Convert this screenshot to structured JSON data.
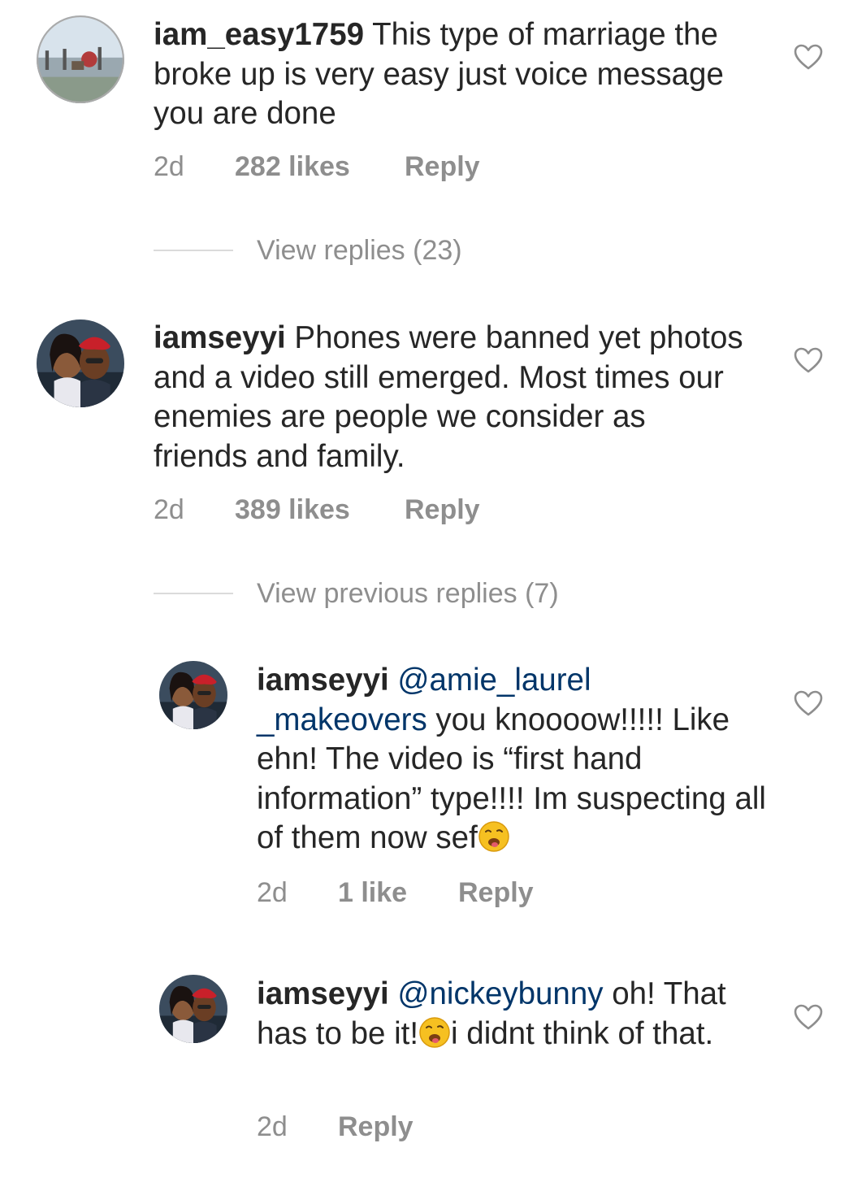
{
  "comments": [
    {
      "username": "iam_easy1759",
      "text": " This type of marriage the broke up is very easy just voice message you are done",
      "time": "2d",
      "likes": "282 likes",
      "reply": "Reply",
      "view_replies": "View replies (23)"
    },
    {
      "username": "iamseyyi",
      "text": " Phones were banned yet photos and a video still emerged. Most times our enemies are people we consider as friends and family.",
      "time": "2d",
      "likes": "389 likes",
      "reply": "Reply",
      "view_replies": "View previous replies (7)",
      "replies": [
        {
          "username": "iamseyyi",
          "mention_line1": "@amie_laurel",
          "mention_line2": "_makeovers",
          "text": " you knoooow!!!!! Like ehn! The video is “first hand information” type!!!! Im suspecting all of them now sef",
          "time": "2d",
          "likes": "1 like",
          "reply": "Reply"
        },
        {
          "username": "iamseyyi",
          "mention": "@nickeybunny",
          "text_a": " oh! That has to be it!",
          "text_b": "i didnt think of that.",
          "time": "2d",
          "reply": "Reply"
        }
      ]
    }
  ],
  "icons": {
    "heart": "heart-outline-icon",
    "emoji": "winking-face-with-tongue-emoji"
  },
  "colors": {
    "text": "#262626",
    "meta": "#8e8e8e",
    "mention": "#003569",
    "divider": "#dbdbdb"
  }
}
